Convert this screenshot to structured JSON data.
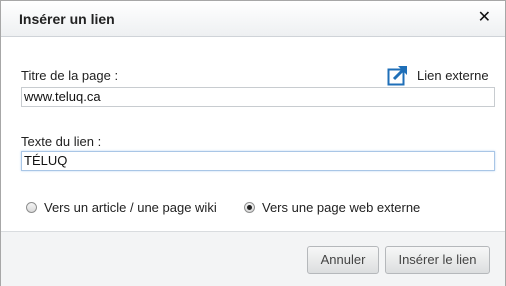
{
  "dialog": {
    "title": "Insérer un lien",
    "close_symbol": "✕"
  },
  "page_title_field": {
    "label": "Titre de la page :",
    "value": "www.teluq.ca"
  },
  "external_link": {
    "icon": "external-link-icon",
    "icon_color": "#1f6fb8",
    "label": "Lien externe"
  },
  "link_text_field": {
    "label": "Texte du lien :",
    "value": "TÉLUQ"
  },
  "link_type": {
    "options": [
      {
        "label": "Vers un article / une page wiki",
        "checked": false
      },
      {
        "label": "Vers une page web externe",
        "checked": true
      }
    ]
  },
  "buttons": {
    "cancel": "Annuler",
    "insert": "Insérer le lien"
  }
}
